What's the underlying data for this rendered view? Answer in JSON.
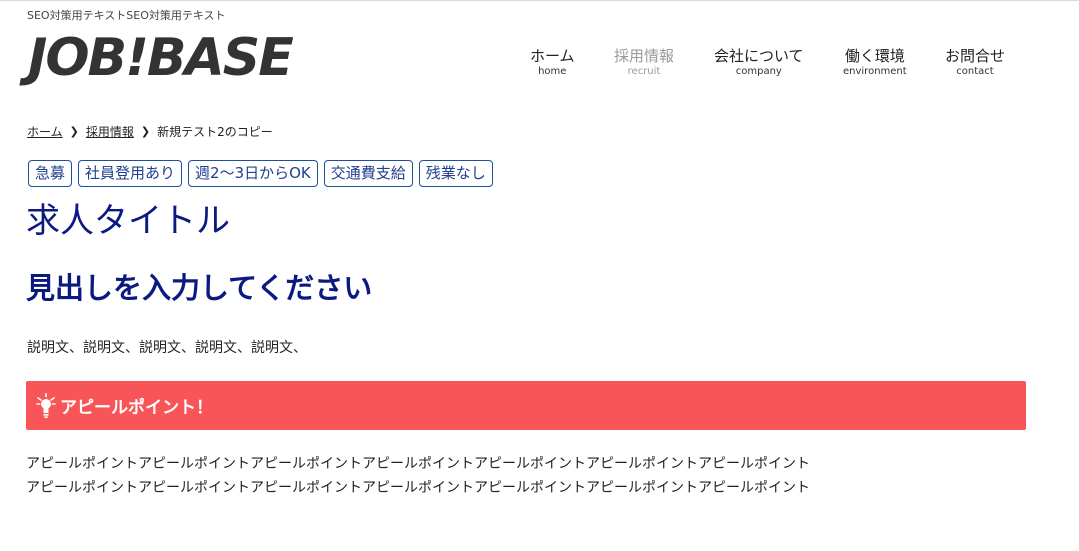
{
  "header": {
    "seo_text": "SEO対策用テキストSEO対策用テキスト",
    "logo_text": "JOB!BASE"
  },
  "nav": {
    "items": [
      {
        "jp": "ホーム",
        "en": "home"
      },
      {
        "jp": "採用情報",
        "en": "recruit"
      },
      {
        "jp": "会社について",
        "en": "company"
      },
      {
        "jp": "働く環境",
        "en": "environment"
      },
      {
        "jp": "お問合せ",
        "en": "contact"
      }
    ]
  },
  "breadcrumb": {
    "home": "ホーム",
    "recruit": "採用情報",
    "current": "新規テスト2のコピー"
  },
  "tags": [
    "急募",
    "社員登用あり",
    "週2〜3日からOK",
    "交通費支給",
    "残業なし"
  ],
  "job": {
    "title": "求人タイトル",
    "heading": "見出しを入力してください",
    "description": "説明文、説明文、説明文、説明文、説明文、"
  },
  "appeal": {
    "label": "アピールポイント！",
    "lines": [
      "アピールポイントアピールポイントアピールポイントアピールポイントアピールポイントアピールポイントアピールポイント",
      "アピールポイントアピールポイントアピールポイントアピールポイントアピールポイントアピールポイントアピールポイント"
    ],
    "bar_color": "#f75557"
  },
  "colors": {
    "heading": "#0b1a80",
    "tag_border": "#1f4e9c"
  }
}
